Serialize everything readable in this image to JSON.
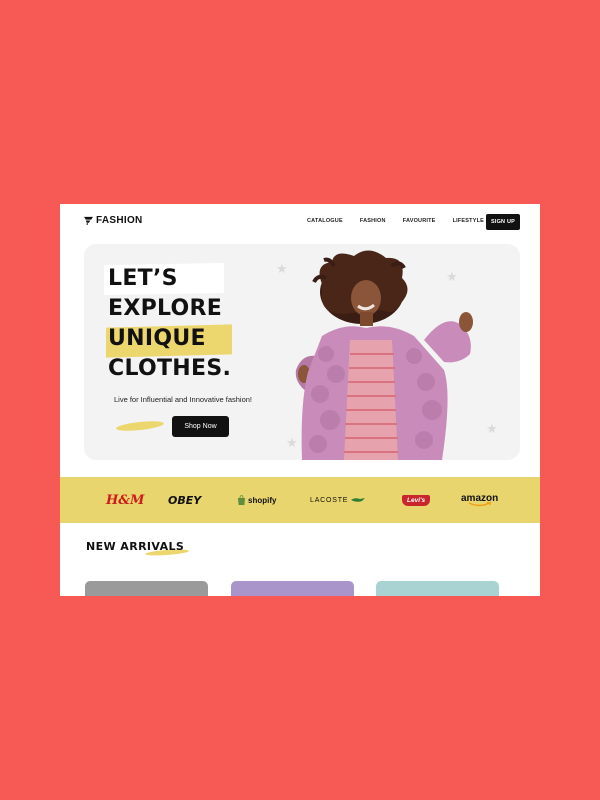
{
  "brand": {
    "name": "FASHION",
    "icon": "fashion-logo-icon"
  },
  "nav": {
    "items": [
      "CATALOGUE",
      "FASHION",
      "FAVOURITE",
      "LIFESTYLE"
    ],
    "signup_label": "SIGN UP"
  },
  "hero": {
    "headline": [
      "LET’S",
      "EXPLORE",
      "UNIQUE",
      "CLOTHES."
    ],
    "tagline": "Live for Influential and Innovative fashion!",
    "cta_label": "Shop Now",
    "photo": "woman-in-pink-fur-coat-photo"
  },
  "brands": [
    "H&M",
    "OBEY",
    "shopify",
    "LACOSTE",
    "Levi's",
    "amazon"
  ],
  "arrivals": {
    "title": "NEW ARRIVALS"
  },
  "colors": {
    "background": "#f75a55",
    "accent_yellow": "#ecd66e",
    "band_yellow": "#e8d56e",
    "dark": "#111111",
    "hero_bg": "#f2f3f2"
  }
}
